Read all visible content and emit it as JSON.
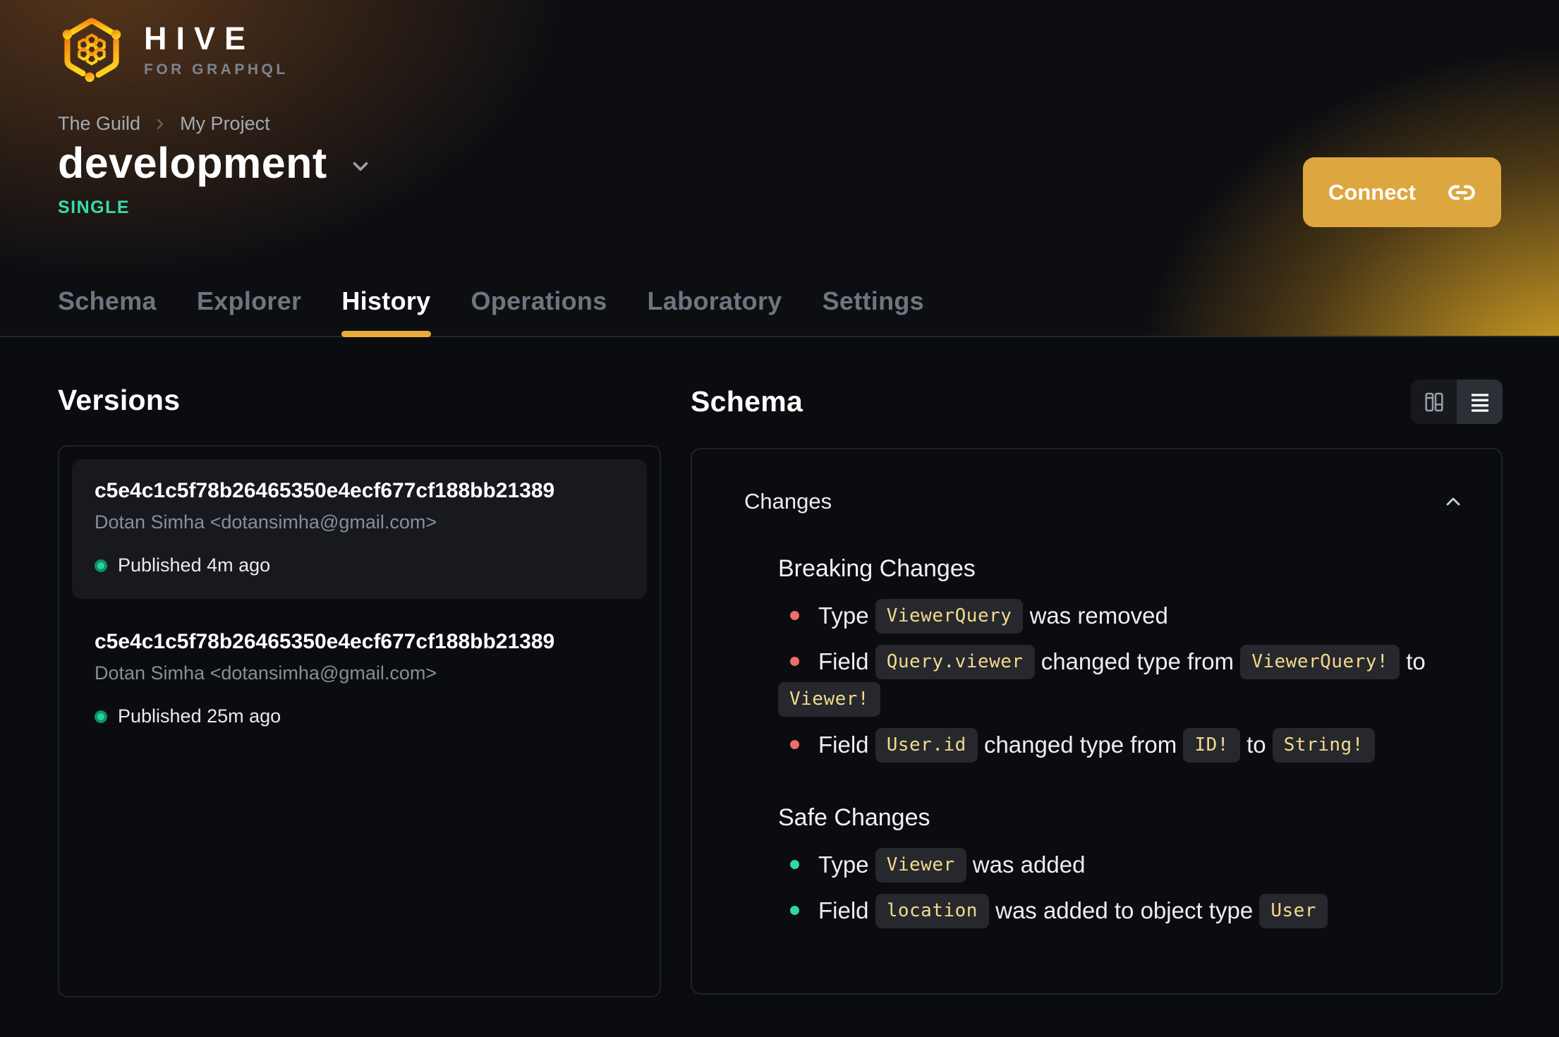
{
  "brand": {
    "name": "HIVE",
    "tagline": "FOR GRAPHQL"
  },
  "breadcrumb": {
    "org": "The Guild",
    "project": "My Project"
  },
  "target": {
    "name": "development",
    "badge": "SINGLE"
  },
  "connect": {
    "label": "Connect"
  },
  "tabs": [
    {
      "label": "Schema",
      "active": false
    },
    {
      "label": "Explorer",
      "active": false
    },
    {
      "label": "History",
      "active": true
    },
    {
      "label": "Operations",
      "active": false
    },
    {
      "label": "Laboratory",
      "active": false
    },
    {
      "label": "Settings",
      "active": false
    }
  ],
  "versions": {
    "title": "Versions",
    "items": [
      {
        "hash": "c5e4c1c5f78b26465350e4ecf677cf188bb21389",
        "author": "Dotan Simha <dotansimha@gmail.com>",
        "status": "Published 4m ago",
        "highlighted": true
      },
      {
        "hash": "c5e4c1c5f78b26465350e4ecf677cf188bb21389",
        "author": "Dotan Simha <dotansimha@gmail.com>",
        "status": "Published 25m ago",
        "highlighted": false
      }
    ]
  },
  "schema": {
    "title": "Schema",
    "view_toggle": {
      "options": [
        "columns-layout-icon",
        "list-layout-icon"
      ],
      "selected": 1
    },
    "changes": {
      "title": "Changes",
      "sections": [
        {
          "heading": "Breaking Changes",
          "kind": "breaking",
          "items": [
            [
              {
                "text": "Type "
              },
              {
                "code": "ViewerQuery"
              },
              {
                "text": " was removed"
              }
            ],
            [
              {
                "text": "Field "
              },
              {
                "code": "Query.viewer"
              },
              {
                "text": " changed type from "
              },
              {
                "code": "ViewerQuery!"
              },
              {
                "text": " to "
              },
              {
                "code": "Viewer!"
              }
            ],
            [
              {
                "text": "Field "
              },
              {
                "code": "User.id"
              },
              {
                "text": " changed type from "
              },
              {
                "code": "ID!"
              },
              {
                "text": " to "
              },
              {
                "code": "String!"
              }
            ]
          ]
        },
        {
          "heading": "Safe Changes",
          "kind": "safe",
          "items": [
            [
              {
                "text": "Type "
              },
              {
                "code": "Viewer"
              },
              {
                "text": " was added"
              }
            ],
            [
              {
                "text": "Field "
              },
              {
                "code": "location"
              },
              {
                "text": " was added to object type "
              },
              {
                "code": "User"
              }
            ]
          ]
        }
      ]
    }
  },
  "icons": {
    "brand": "hive-logo-icon",
    "connect": "link-icon",
    "breadcrumb_separator": "chevron-right-icon",
    "target_selector": "chevron-down-icon",
    "changes_collapse": "chevron-up-icon"
  },
  "colors": {
    "accent": "#DEA63E",
    "badge_green": "#38DCA8",
    "breaking": "#EE6B6E",
    "safe": "#35D69B",
    "chip_text": "#F5D98B",
    "dot": "#24D69A"
  }
}
